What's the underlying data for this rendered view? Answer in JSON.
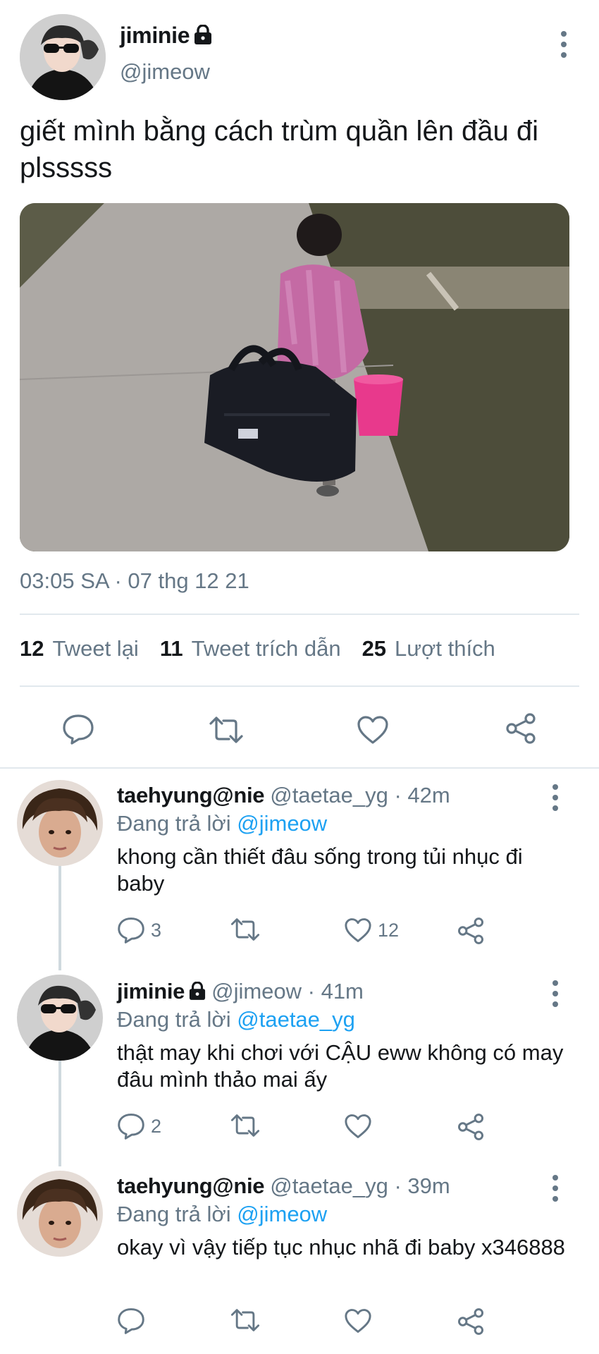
{
  "main_tweet": {
    "display_name": "jiminie",
    "handle": "@jimeow",
    "text": "giết mình bằng cách trùm quần lên đầu đi plsssss",
    "timestamp": "03:05 SA · 07 thg 12 21",
    "stats": [
      {
        "count": "12",
        "label": "Tweet lại"
      },
      {
        "count": "11",
        "label": "Tweet trích dẫn"
      },
      {
        "count": "25",
        "label": "Lượt thích"
      }
    ],
    "icons": [
      "reply-icon",
      "retweet-icon",
      "like-icon",
      "share-icon"
    ]
  },
  "replies": [
    {
      "display_name": "taehyung@nie",
      "meta": "@taetae_yg · 42m",
      "replying_prefix": "Đang trả lời",
      "replying_to": "@jimeow",
      "text": "khong cần thiết đâu sống trong tủi nhục đi baby",
      "reply_count": "3",
      "like_count": "12"
    },
    {
      "display_name": "jiminie",
      "meta": "@jimeow · 41m",
      "replying_prefix": "Đang trả lời",
      "replying_to": "@taetae_yg",
      "text": "thật may khi chơi với CẬU eww không có may đâu mình thảo mai ấy",
      "reply_count": "2",
      "like_count": ""
    },
    {
      "display_name": "taehyung@nie",
      "meta": "@taetae_yg · 39m",
      "replying_prefix": "Đang trả lời",
      "replying_to": "@jimeow",
      "text": "okay vì vậy tiếp tục nhục nhã đi baby x346888",
      "reply_count": "",
      "like_count": ""
    }
  ],
  "colors": {
    "text": "#14171a",
    "secondary": "#657786",
    "link": "#1da1f2",
    "divider": "#e1e8ed"
  }
}
